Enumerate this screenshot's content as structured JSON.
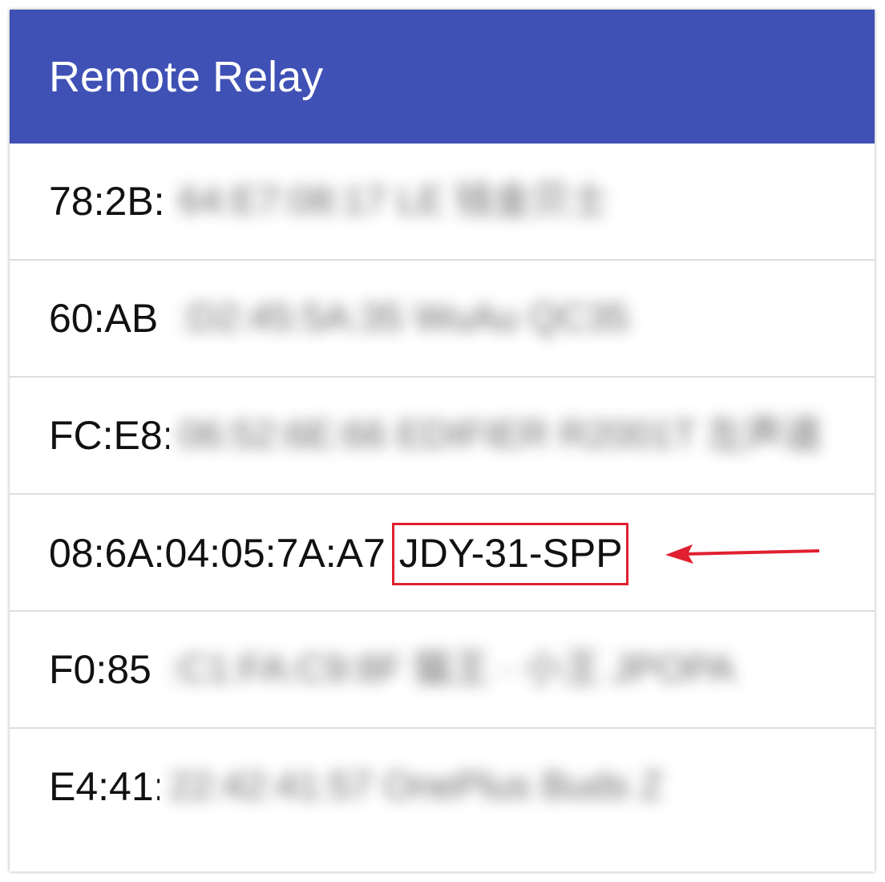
{
  "appbar": {
    "title": "Remote Relay",
    "color": "#3f51b5"
  },
  "devices": [
    {
      "address_visible": "78:2B:",
      "rest_blurred": "64:E7:08:17 LE 钱金贝士"
    },
    {
      "address_visible": "60:AB",
      "rest_blurred": ":D2:45:5A:35 WuAu QC35"
    },
    {
      "address_visible": "FC:E8:",
      "rest_blurred": "06:52:6E:66 EDIFIER R2001T 左声道"
    },
    {
      "address_visible": "08:6A:04:05:7A:A7",
      "name": "JDY-31-SPP"
    },
    {
      "address_visible": "F0:85",
      "rest_blurred": ":C1:FA:C9:8F 猫王 · 小王 JPOPA"
    },
    {
      "address_visible": "E4:41:",
      "rest_blurred": "22:42:41:57 OnePlus Buds Z"
    }
  ],
  "annotation": {
    "highlight_color": "#e02030",
    "arrow_icon": "red-arrow-pointing-left"
  }
}
